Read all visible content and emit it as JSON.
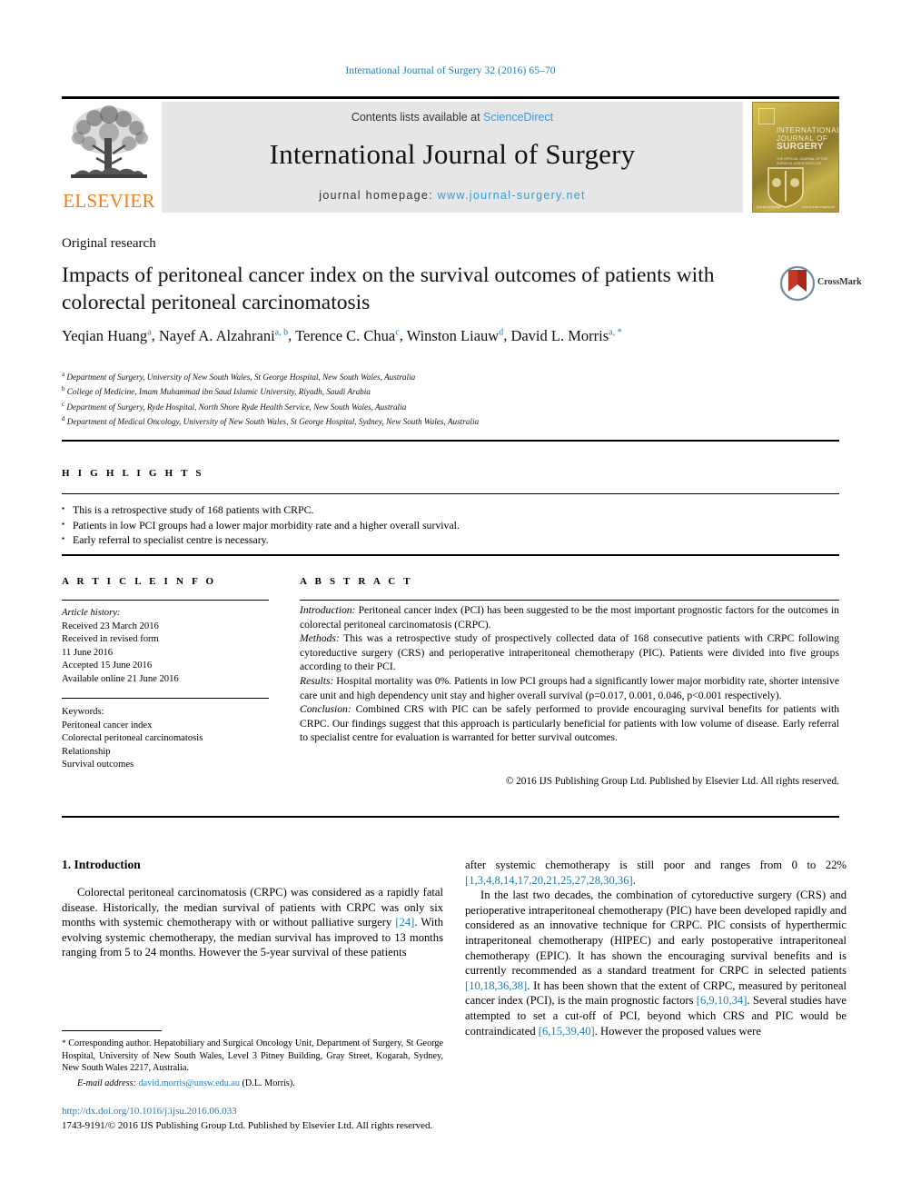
{
  "running_head": "International Journal of Surgery 32 (2016) 65–70",
  "masthead": {
    "contents_prefix": "Contents lists available at ",
    "sciencedirect": "ScienceDirect",
    "journal_title": "International Journal of Surgery",
    "homepage_prefix": "journal homepage: ",
    "homepage_url": "www.journal-surgery.net",
    "publisher_logo_text": "ELSEVIER",
    "cover": {
      "line1": "INTERNATIONAL",
      "line2": "JOURNAL OF",
      "line3": "SURGERY",
      "sub": "THE OFFICIAL JOURNAL OF THE\nSURGICAL ASSOCIATES LTD",
      "foot_left": "journal homepage",
      "foot_right": "www.journal-surgery.net"
    }
  },
  "article": {
    "type": "Original research",
    "title": "Impacts of peritoneal cancer index on the survival outcomes of patients with colorectal peritoneal carcinomatosis",
    "crossmark_label": "CrossMark",
    "authors": [
      {
        "name": "Yeqian Huang",
        "marks": "a"
      },
      {
        "name": "Nayef A. Alzahrani",
        "marks": "a, b"
      },
      {
        "name": "Terence C. Chua",
        "marks": "c"
      },
      {
        "name": "Winston Liauw",
        "marks": "d"
      },
      {
        "name": "David L. Morris",
        "marks": "a, *"
      }
    ],
    "affiliations": [
      {
        "mark": "a",
        "text": "Department of Surgery, University of New South Wales, St George Hospital, New South Wales, Australia"
      },
      {
        "mark": "b",
        "text": "College of Medicine, Imam Muhammad ibn Saud Islamic University, Riyadh, Saudi Arabia"
      },
      {
        "mark": "c",
        "text": "Department of Surgery, Ryde Hospital, North Shore Ryde Health Service, New South Wales, Australia"
      },
      {
        "mark": "d",
        "text": "Department of Medical Oncology, University of New South Wales, St George Hospital, Sydney, New South Wales, Australia"
      }
    ]
  },
  "highlights": {
    "heading": "H I G H L I G H T S",
    "items": [
      "This is a retrospective study of 168 patients with CRPC.",
      "Patients in low PCI groups had a lower major morbidity rate and a higher overall survival.",
      "Early referral to specialist centre is necessary."
    ]
  },
  "article_info": {
    "heading": "A R T I C L E   I N F O",
    "history_label": "Article history:",
    "history": [
      "Received 23 March 2016",
      "Received in revised form",
      "11 June 2016",
      "Accepted 15 June 2016",
      "Available online 21 June 2016"
    ],
    "keywords_label": "Keywords:",
    "keywords": [
      "Peritoneal cancer index",
      "Colorectal peritoneal carcinomatosis",
      "Relationship",
      "Survival outcomes"
    ]
  },
  "abstract": {
    "heading": "A B S T R A C T",
    "sections": [
      {
        "label": "Introduction:",
        "text": "Peritoneal cancer index (PCI) has been suggested to be the most important prognostic factors for the outcomes in colorectal peritoneal carcinomatosis (CRPC)."
      },
      {
        "label": "Methods:",
        "text": "This was a retrospective study of prospectively collected data of 168 consecutive patients with CRPC following cytoreductive surgery (CRS) and perioperative intraperitoneal chemotherapy (PIC). Patients were divided into five groups according to their PCI."
      },
      {
        "label": "Results:",
        "text": "Hospital mortality was 0%. Patients in low PCI groups had a significantly lower major morbidity rate, shorter intensive care unit and high dependency unit stay and higher overall survival (p=0.017, 0.001, 0.046, p<0.001 respectively)."
      },
      {
        "label": "Conclusion:",
        "text": "Combined CRS with PIC can be safely performed to provide encouraging survival benefits for patients with CRPC. Our findings suggest that this approach is particularly beneficial for patients with low volume of disease. Early referral to specialist centre for evaluation is warranted for better survival outcomes."
      }
    ],
    "copyright": "© 2016 IJS Publishing Group Ltd. Published by Elsevier Ltd. All rights reserved."
  },
  "body": {
    "section_heading": "1. Introduction",
    "left_paragraph": "Colorectal peritoneal carcinomatosis (CRPC) was considered as a rapidly fatal disease. Historically, the median survival of patients with CRPC was only six months with systemic chemotherapy with or without palliative surgery ",
    "left_ref_1": "[24]",
    "left_paragraph_cont": ". With evolving systemic chemotherapy, the median survival has improved to 13 months ranging from 5 to 24 months. However the 5-year survival of these patients",
    "right_paragraph_1a": "after systemic chemotherapy is still poor and ranges from 0 to 22% ",
    "right_ref_1": "[1,3,4,8,14,17,20,21,25,27,28,30,36]",
    "right_paragraph_1b": ".",
    "right_paragraph_2a": "In the last two decades, the combination of cytoreductive surgery (CRS) and perioperative intraperitoneal chemotherapy (PIC) have been developed rapidly and considered as an innovative technique for CRPC. PIC consists of hyperthermic intraperitoneal chemotherapy (HIPEC) and early postoperative intraperitoneal chemotherapy (EPIC). It has shown the encouraging survival benefits and is currently recommended as a standard treatment for CRPC in selected patients ",
    "right_ref_2": "[10,18,36,38]",
    "right_paragraph_2b": ". It has been shown that the extent of CRPC, measured by peritoneal cancer index (PCI), is the main prognostic factors ",
    "right_ref_3": "[6,9,10,34]",
    "right_paragraph_2c": ". Several studies have attempted to set a cut-off of PCI, beyond which CRS and PIC would be contraindicated ",
    "right_ref_4": "[6,15,39,40]",
    "right_paragraph_2d": ". However the proposed values were"
  },
  "footer": {
    "corresponding_star": "*",
    "corresponding_text": "Corresponding author. Hepatobiliary and Surgical Oncology Unit, Department of Surgery, St George Hospital, University of New South Wales, Level 3 Pitney Building, Gray Street, Kogarah, Sydney, New South Wales 2217, Australia.",
    "email_label": "E-mail address:",
    "email": "david.morris@unsw.edu.au",
    "email_suffix": "(D.L. Morris).",
    "doi": "http://dx.doi.org/10.1016/j.ijsu.2016.06.033",
    "issn": "1743-9191/© 2016 IJS Publishing Group Ltd. Published by Elsevier Ltd. All rights reserved."
  },
  "colors": {
    "link": "#1f7bb6",
    "science_direct": "#3a9bd4",
    "elsevier_orange": "#f07f1a",
    "masthead_bg": "#e6e6e6"
  }
}
